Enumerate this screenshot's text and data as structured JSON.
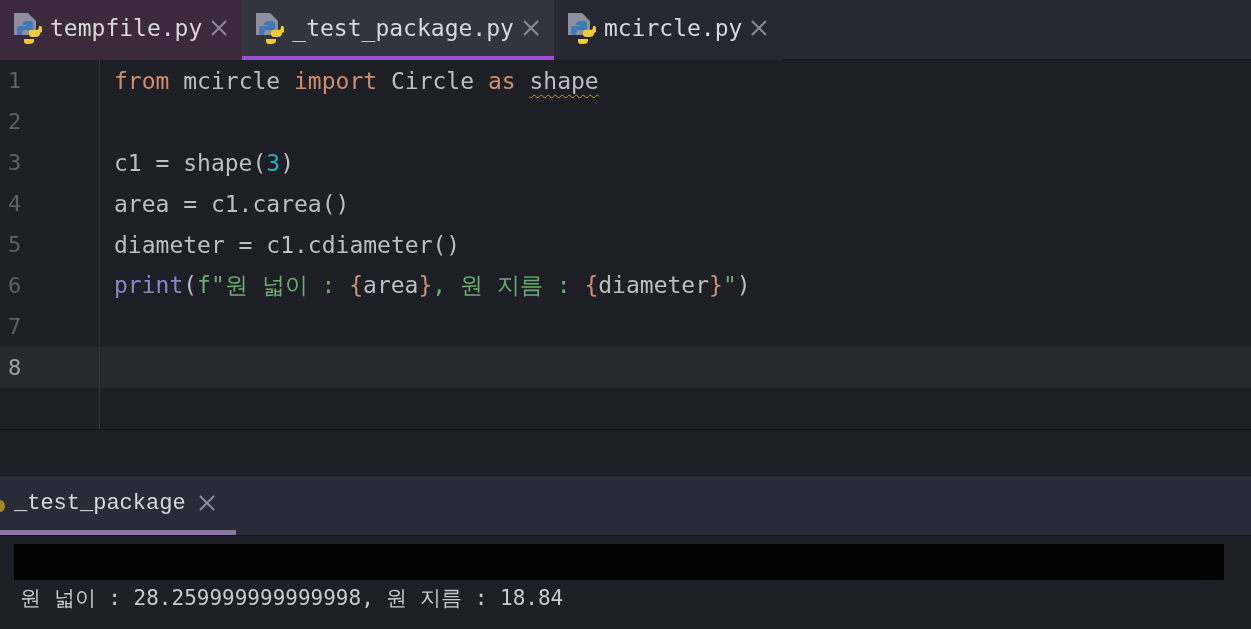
{
  "editor_tabs": [
    {
      "label": "tempfile.py",
      "selected": false,
      "pinned": true
    },
    {
      "label": "_test_package.py",
      "selected": true,
      "pinned": false
    },
    {
      "label": "mcircle.py",
      "selected": false,
      "pinned": false
    }
  ],
  "code_lines": [
    {
      "number": "1",
      "current": false,
      "tokens": [
        {
          "text": "from",
          "kind": "keyword"
        },
        {
          "text": " mcircle ",
          "kind": "plain"
        },
        {
          "text": "import",
          "kind": "keyword"
        },
        {
          "text": " Circle ",
          "kind": "plain"
        },
        {
          "text": "as ",
          "kind": "keyword"
        },
        {
          "text": "shape",
          "kind": "warning"
        }
      ]
    },
    {
      "number": "2",
      "current": false
    },
    {
      "number": "3",
      "current": false,
      "tokens": [
        {
          "text": "c1 = shape(",
          "kind": "plain"
        },
        {
          "text": "3",
          "kind": "number"
        },
        {
          "text": ")",
          "kind": "plain"
        }
      ]
    },
    {
      "number": "4",
      "current": false,
      "tokens": [
        {
          "text": "area = c1.carea()",
          "kind": "plain"
        }
      ]
    },
    {
      "number": "5",
      "current": false,
      "tokens": [
        {
          "text": "diameter = c1.cdiameter()",
          "kind": "plain"
        }
      ]
    },
    {
      "number": "6",
      "current": false,
      "tokens": [
        {
          "text": "print",
          "kind": "builtin"
        },
        {
          "text": "(",
          "kind": "plain"
        },
        {
          "text": "f\"원 넓이 : ",
          "kind": "string"
        },
        {
          "text": "{",
          "kind": "brace"
        },
        {
          "text": "area",
          "kind": "plain"
        },
        {
          "text": "}",
          "kind": "brace"
        },
        {
          "text": ", 원 지름 : ",
          "kind": "string"
        },
        {
          "text": "{",
          "kind": "brace"
        },
        {
          "text": "diameter",
          "kind": "plain"
        },
        {
          "text": "}",
          "kind": "brace"
        },
        {
          "text": "\"",
          "kind": "string"
        },
        {
          "text": ")",
          "kind": "plain"
        }
      ]
    },
    {
      "number": "7",
      "current": false
    },
    {
      "number": "8",
      "current": true
    }
  ],
  "console": {
    "tab": {
      "label": "_test_package",
      "selected": true
    },
    "output": [
      "원 넓이 : 28.259999999999998, 원 지름 : 18.84"
    ]
  }
}
